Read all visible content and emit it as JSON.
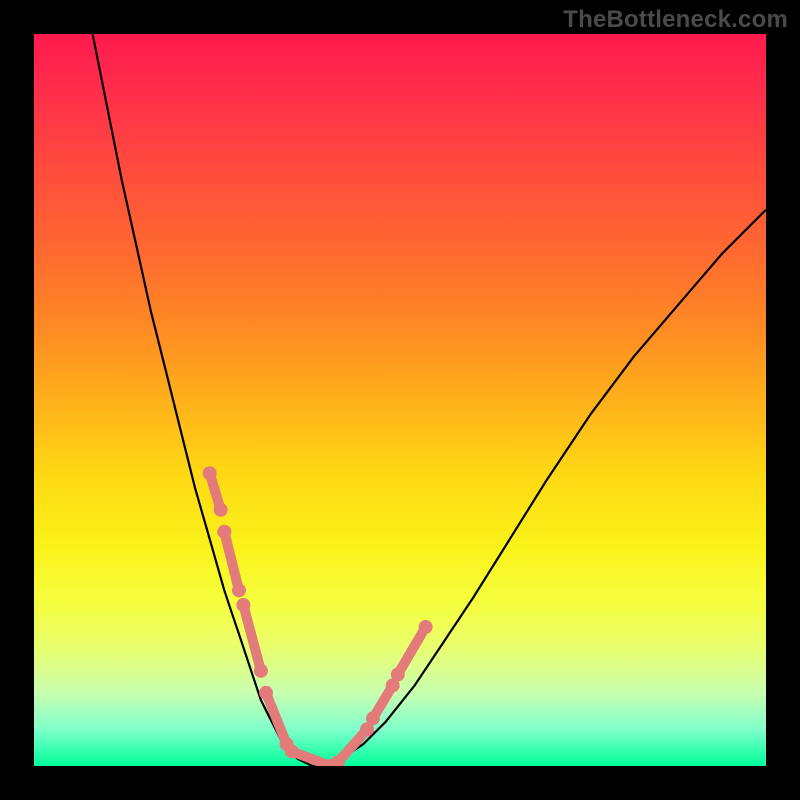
{
  "watermark": "TheBottleneck.com",
  "chart_data": {
    "type": "line",
    "title": "",
    "xlabel": "",
    "ylabel": "",
    "xlim": [
      0,
      100
    ],
    "ylim": [
      0,
      100
    ],
    "grid": false,
    "series": [
      {
        "name": "curve",
        "x": [
          8,
          10,
          12,
          14,
          16,
          18,
          20,
          22,
          24,
          26,
          27,
          28,
          29,
          30,
          31,
          32,
          33,
          34,
          35,
          36,
          38,
          40,
          42,
          45,
          48,
          52,
          56,
          60,
          65,
          70,
          76,
          82,
          88,
          94,
          100
        ],
        "y": [
          100,
          90,
          80,
          71,
          62,
          54,
          46,
          38,
          31,
          24,
          21,
          18,
          15,
          12,
          9,
          7,
          5,
          3,
          2,
          1,
          0,
          0,
          1,
          3,
          6,
          11,
          17,
          23,
          31,
          39,
          48,
          56,
          63,
          70,
          76
        ]
      }
    ],
    "overlay_segments": [
      {
        "x0": 24.0,
        "y0": 40,
        "x1": 25.5,
        "y1": 35
      },
      {
        "x0": 26.0,
        "y0": 32,
        "x1": 28.0,
        "y1": 24
      },
      {
        "x0": 28.6,
        "y0": 22,
        "x1": 31.0,
        "y1": 13
      },
      {
        "x0": 31.7,
        "y0": 10,
        "x1": 34.5,
        "y1": 3
      },
      {
        "x0": 35.2,
        "y0": 2,
        "x1": 40.5,
        "y1": 0
      },
      {
        "x0": 41.5,
        "y0": 0.5,
        "x1": 45.5,
        "y1": 5
      },
      {
        "x0": 46.3,
        "y0": 6.5,
        "x1": 49.0,
        "y1": 11
      },
      {
        "x0": 49.7,
        "y0": 12.5,
        "x1": 53.5,
        "y1": 19
      }
    ],
    "overlay_points": [
      {
        "x": 24.0,
        "y": 40
      },
      {
        "x": 25.5,
        "y": 35
      },
      {
        "x": 26.0,
        "y": 32
      },
      {
        "x": 28.0,
        "y": 24
      },
      {
        "x": 28.6,
        "y": 22
      },
      {
        "x": 31.0,
        "y": 13
      },
      {
        "x": 31.7,
        "y": 10
      },
      {
        "x": 34.5,
        "y": 3
      },
      {
        "x": 35.2,
        "y": 2
      },
      {
        "x": 40.5,
        "y": 0
      },
      {
        "x": 41.5,
        "y": 0.5
      },
      {
        "x": 45.5,
        "y": 5
      },
      {
        "x": 46.3,
        "y": 6.5
      },
      {
        "x": 49.0,
        "y": 11
      },
      {
        "x": 49.7,
        "y": 12.5
      },
      {
        "x": 53.5,
        "y": 19
      }
    ]
  }
}
